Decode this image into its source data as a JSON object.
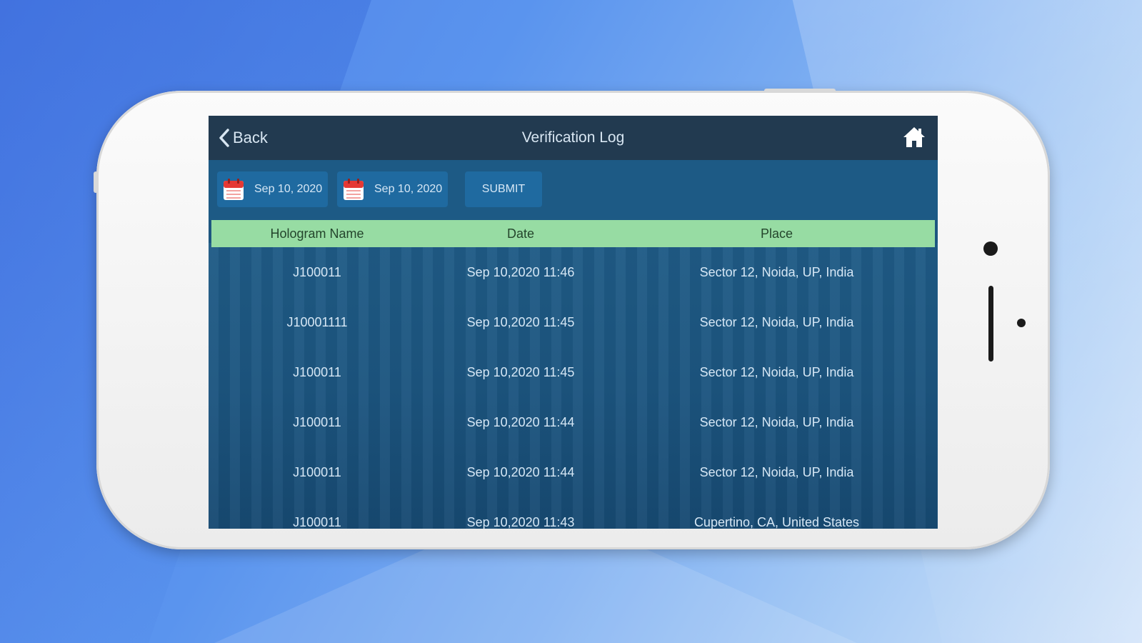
{
  "app": {
    "nav": {
      "back_label": "Back",
      "title": "Verification Log"
    },
    "filters": {
      "from_date": "Sep 10, 2020",
      "to_date": "Sep 10, 2020",
      "submit_label": "SUBMIT"
    },
    "table": {
      "headers": [
        "Hologram Name",
        "Date",
        "Place"
      ],
      "rows": [
        {
          "name": "J100011",
          "date": "Sep 10,2020 11:46",
          "place": "Sector 12, Noida, UP, India"
        },
        {
          "name": "J10001111",
          "date": "Sep 10,2020 11:45",
          "place": "Sector 12, Noida, UP, India"
        },
        {
          "name": "J100011",
          "date": "Sep 10,2020 11:45",
          "place": "Sector 12, Noida, UP, India"
        },
        {
          "name": "J100011",
          "date": "Sep 10,2020 11:44",
          "place": "Sector 12, Noida, UP, India"
        },
        {
          "name": "J100011",
          "date": "Sep 10,2020 11:44",
          "place": "Sector 12, Noida, UP, India"
        },
        {
          "name": "J100011",
          "date": "Sep 10,2020 11:43",
          "place": "Cupertino, CA, United States"
        }
      ]
    }
  },
  "icons": {
    "back": "chevron-left-icon",
    "home": "home-icon",
    "calendar": "calendar-icon"
  },
  "colors": {
    "nav_bar": "#223a50",
    "screen_bg": "#1d5680",
    "button_bg": "#1f6aa0",
    "header_row": "#97dca3",
    "calendar_red": "#e53935"
  }
}
